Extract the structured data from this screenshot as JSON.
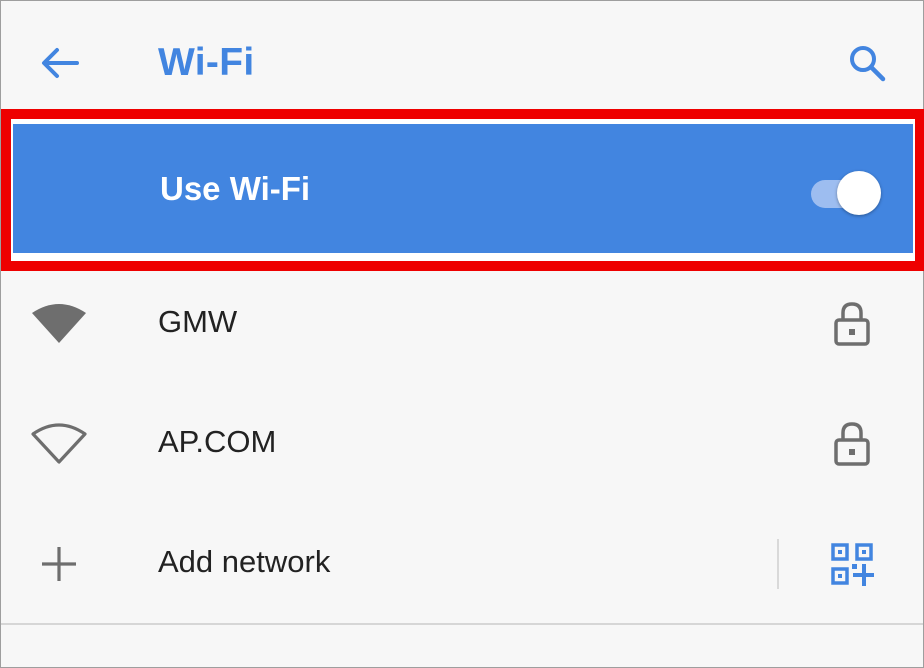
{
  "colors": {
    "accent": "#4285e0",
    "highlight_border": "#ee0000",
    "icon_gray": "#6e6e6e",
    "background": "#f7f7f7"
  },
  "appbar": {
    "back_icon": "arrow-back-icon",
    "title": "Wi-Fi",
    "search_icon": "search-icon"
  },
  "wifi_toggle": {
    "label": "Use Wi-Fi",
    "state": "on"
  },
  "networks": [
    {
      "name": "GMW",
      "signal_icon": "wifi-signal-full-icon",
      "secured_icon": "lock-icon"
    },
    {
      "name": "AP.COM",
      "signal_icon": "wifi-signal-outline-icon",
      "secured_icon": "lock-icon"
    }
  ],
  "add_network": {
    "label": "Add network",
    "lead_icon": "plus-icon",
    "trail_icon": "qr-code-scan-icon"
  }
}
